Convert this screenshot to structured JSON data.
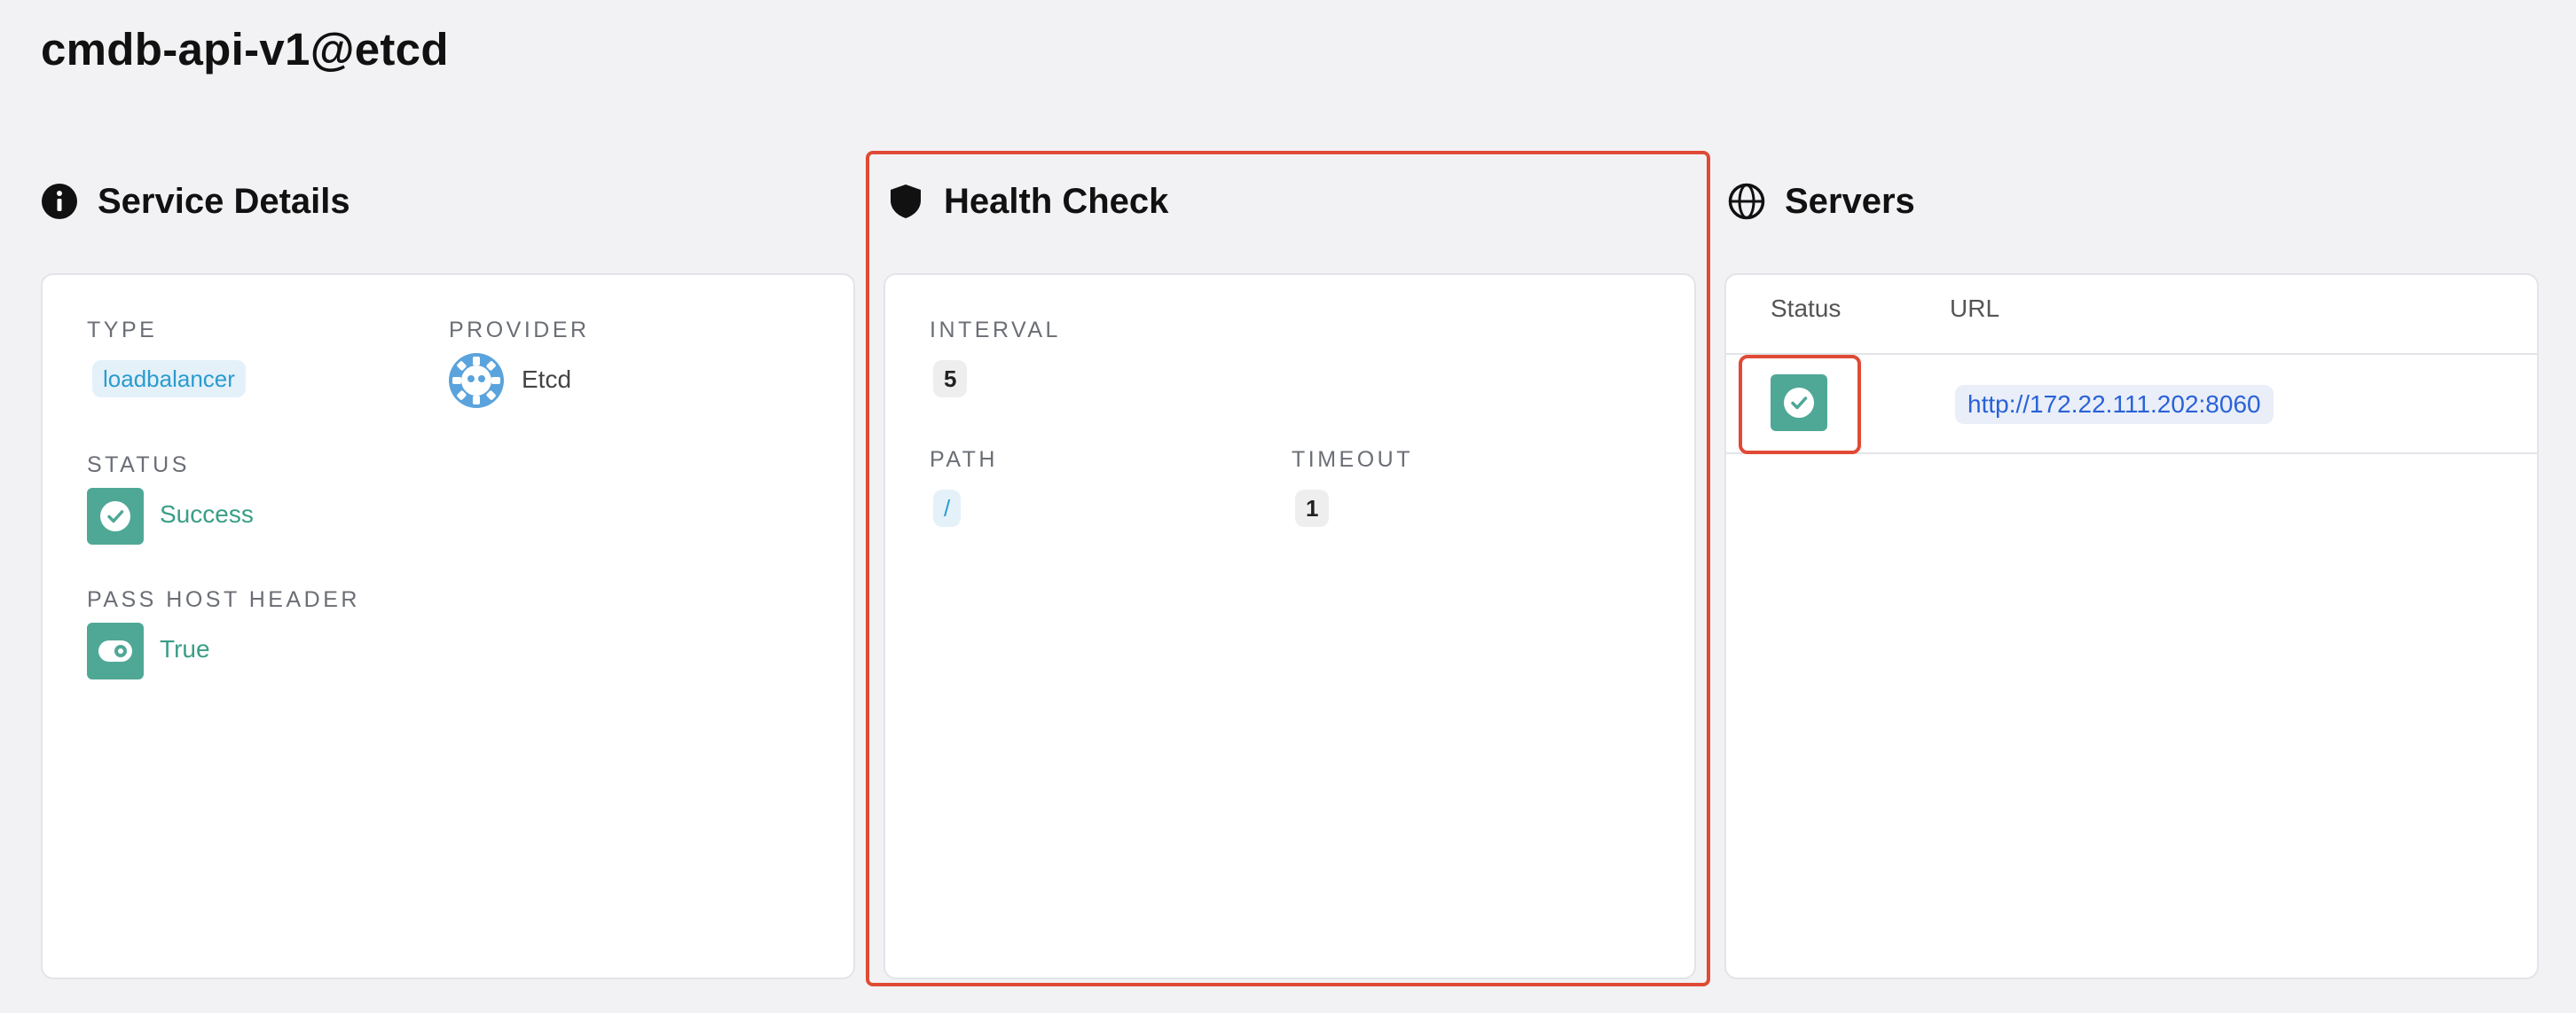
{
  "page": {
    "title": "cmdb-api-v1@etcd"
  },
  "service_details": {
    "heading": "Service Details",
    "icon": "info-icon",
    "type_label": "TYPE",
    "type_value": "loadbalancer",
    "provider_label": "PROVIDER",
    "provider_value": "Etcd",
    "provider_icon": "etcd-logo-icon",
    "status_label": "STATUS",
    "status_value": "Success",
    "pass_host_header_label": "PASS HOST HEADER",
    "pass_host_header_value": "True"
  },
  "health_check": {
    "heading": "Health Check",
    "icon": "shield-icon",
    "interval_label": "INTERVAL",
    "interval_value": "5",
    "path_label": "PATH",
    "path_value": "/",
    "timeout_label": "TIMEOUT",
    "timeout_value": "1"
  },
  "servers": {
    "heading": "Servers",
    "icon": "globe-icon",
    "columns": [
      "Status",
      "URL"
    ],
    "rows": [
      {
        "status": "success",
        "url": "http://172.22.111.202:8060"
      }
    ]
  },
  "colors": {
    "success": "#4fa896",
    "highlight": "#e04a35",
    "chip_blue_text": "#2a9bd0",
    "link": "#2962d8"
  }
}
